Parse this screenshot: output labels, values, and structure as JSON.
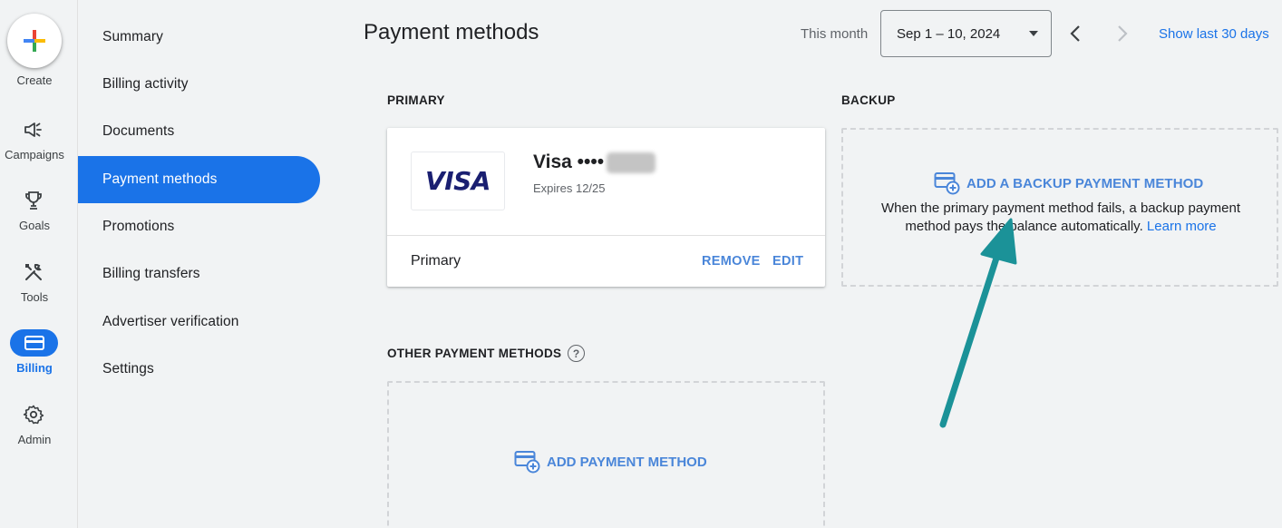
{
  "rail": {
    "create": "Create",
    "campaigns": "Campaigns",
    "goals": "Goals",
    "tools": "Tools",
    "billing": "Billing",
    "admin": "Admin"
  },
  "subnav": {
    "items": [
      {
        "label": "Summary"
      },
      {
        "label": "Billing activity"
      },
      {
        "label": "Documents"
      },
      {
        "label": "Payment methods"
      },
      {
        "label": "Promotions"
      },
      {
        "label": "Billing transfers"
      },
      {
        "label": "Advertiser verification"
      },
      {
        "label": "Settings"
      }
    ],
    "active_index": 3
  },
  "header": {
    "title": "Payment methods",
    "period_label": "This month",
    "date_range": "Sep 1 – 10, 2024",
    "show_last": "Show last 30 days"
  },
  "primary": {
    "section_label": "PRIMARY",
    "brand_logo": "VISA",
    "card_name": "Visa ••••",
    "expires": "Expires 12/25",
    "status": "Primary",
    "remove_label": "REMOVE",
    "edit_label": "EDIT"
  },
  "backup": {
    "section_label": "BACKUP",
    "add_label": "ADD A BACKUP PAYMENT METHOD",
    "description": "When the primary payment method fails, a backup payment method pays the balance automatically.",
    "learn_more": "Learn more"
  },
  "other": {
    "section_label": "OTHER PAYMENT METHODS",
    "help_glyph": "?",
    "add_label": "ADD PAYMENT METHOD"
  },
  "colors": {
    "accent": "#1a73e8",
    "link": "#4a86d9",
    "annotation_arrow": "#1b9298",
    "background": "#f1f3f4"
  }
}
